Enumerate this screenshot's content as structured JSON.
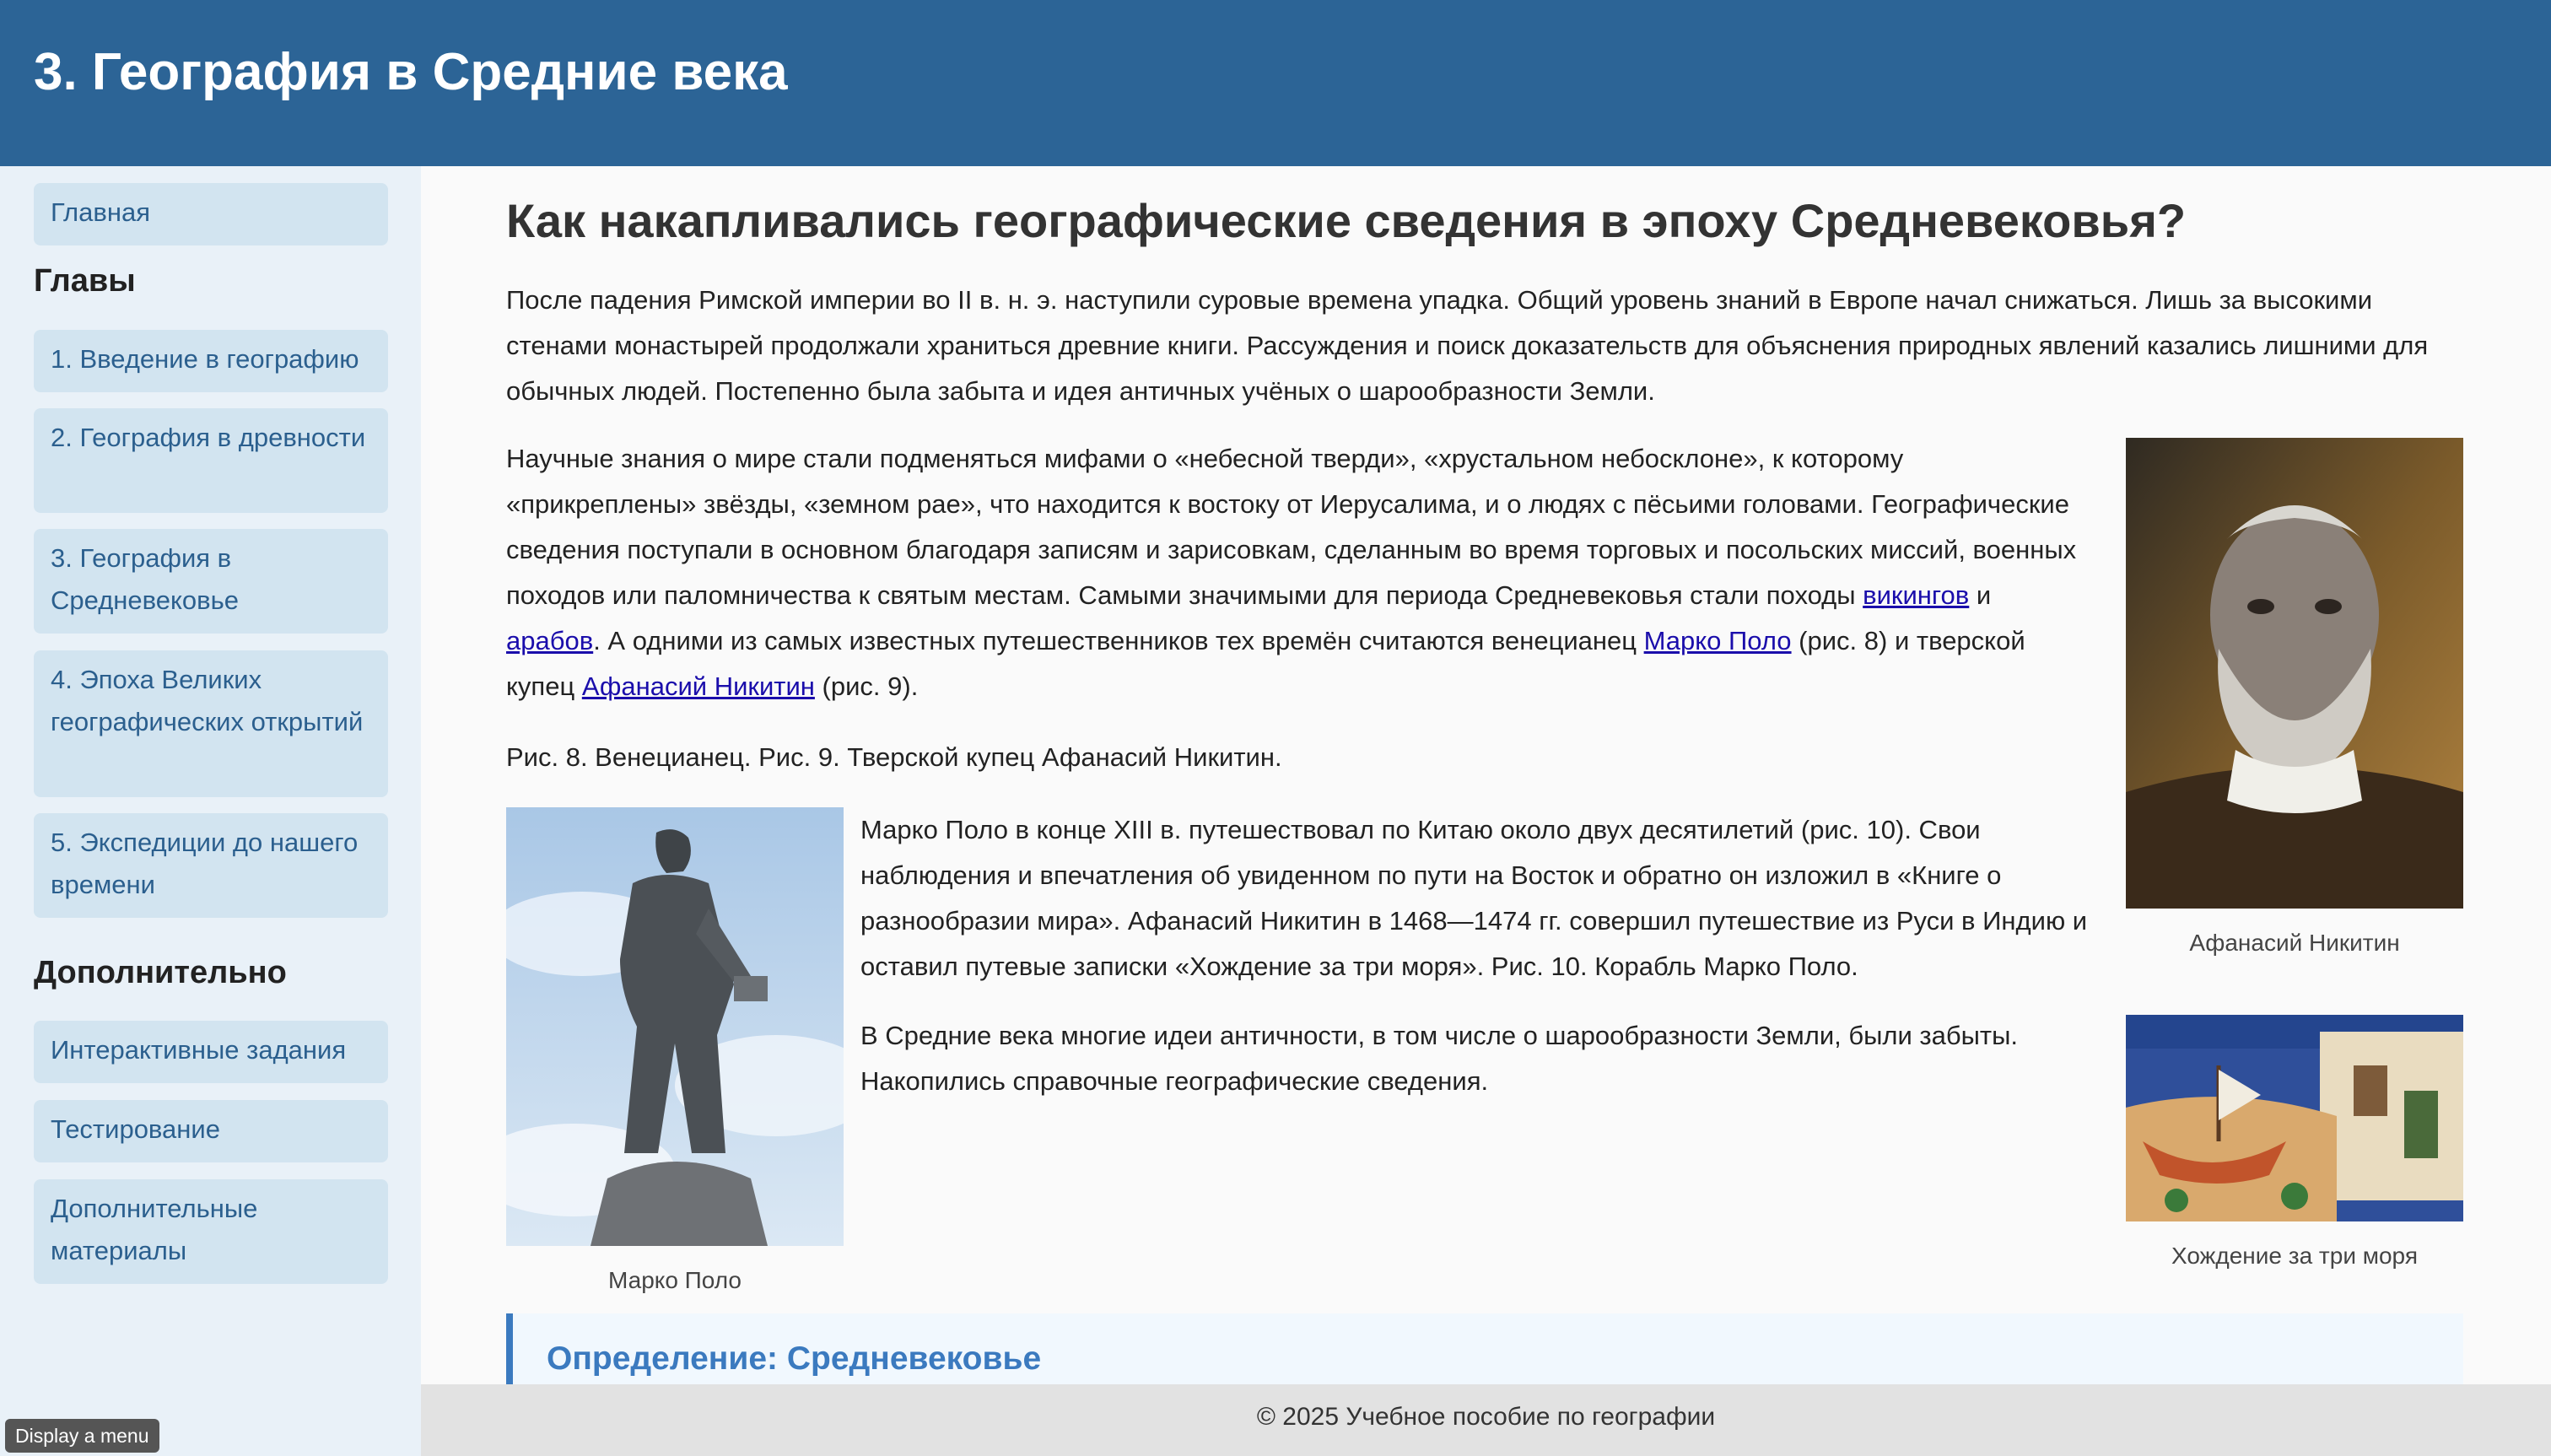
{
  "header": {
    "title": "3. География в Средние века"
  },
  "sidebar": {
    "home": "Главная",
    "chapters_heading": "Главы",
    "chapters": [
      "1. Введение в географию",
      "2. География в древности",
      "3. География в Средневековье",
      "4. Эпоха Великих географических открытий",
      "5. Экспедиции до нашего времени"
    ],
    "extra_heading": "Дополнительно",
    "extra": [
      "Интерактивные задания",
      "Тестирование",
      "Дополнительные материалы"
    ]
  },
  "main": {
    "heading": "Как накапливались географические сведения в эпоху Средневековья?",
    "p1": "После падения Римской империи во II в. н. э. наступили суровые времена упадка. Общий уровень знаний в Европе начал снижаться. Лишь за высокими стенами монастырей продолжали храниться древние книги. Рассуждения и поиск доказательств для объяснения природных явлений казались лишними для обычных людей. Постепенно была забыта и идея античных учёных о шарообразности Земли.",
    "p2_before": "Научные знания о мире стали подменяться мифами о «небесной тверди», «хрустальном небосклоне», к которому «прикреплены» звёзды, «земном рае», что находится к востоку от Иерусалима, и о людях с пёсьими головами. Географические сведения поступали в основном благодаря записям и зарисовкам, сделанным во время торговых и посольских миссий, военных походов или паломничества к святым местам. Самыми значимыми для периода Средневековья стали походы ",
    "link_vikings": "викингов",
    "and": " и ",
    "link_arabs": "арабов",
    "p2_mid": ". А одними из самых известных путешественников тех времён считаются венецианец ",
    "link_marco": "Марко Поло",
    "p2_mid2": " (рис. 8) и тверской купец ",
    "link_afanasy": "Афанасий Никитин",
    "p2_end": " (рис. 9).",
    "p3": "Рис. 8. Венецианец. Рис. 9. Тверской купец Афанасий Никитин.",
    "p4": "Марко Поло в конце XIII в. путешествовал по Китаю около двух десятилетий (рис. 10). Свои наблюдения и впечатления об увиденном по пути на Восток и обратно он изложил в «Книге о разнообразии мира». Афанасий Никитин в 1468—1474 гг. совершил путешествие из Руси в Индию и оставил путевые записки «Хождение за три моря». Рис. 10. Корабль Марко Поло.",
    "p5": "В Средние века многие идеи античности, в том числе о шарообразности Земли, были забыты. Накопились справочные географические сведения.",
    "fig_afanasy_caption": "Афанасий Никитин",
    "fig_marco_caption": "Марко Поло",
    "fig_ship_caption": "Хождение за три моря",
    "definition_title": "Определение: Средневековье"
  },
  "footer": {
    "text": "© 2025 Учебное пособие по географии"
  },
  "tooltip": {
    "text": "Display a menu"
  }
}
